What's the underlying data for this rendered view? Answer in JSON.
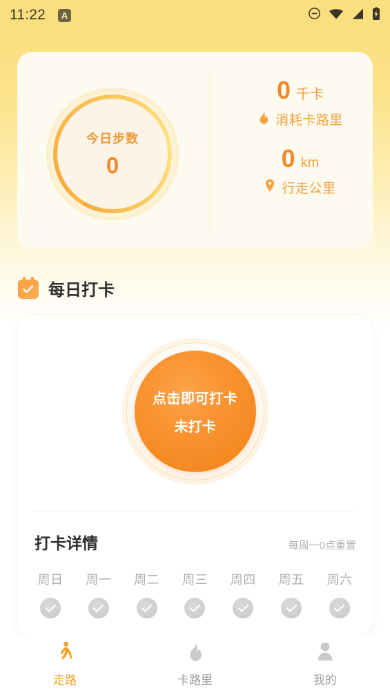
{
  "statusbar": {
    "time": "11:22",
    "badge_letter": "A",
    "icons": [
      "do-not-disturb-icon",
      "wifi-icon",
      "cellular-signal-icon",
      "battery-charging-icon"
    ]
  },
  "summary": {
    "steps": {
      "label": "今日步数",
      "value": "0"
    },
    "calories": {
      "value": "0",
      "unit": "千卡",
      "caption": "消耗卡路里",
      "icon": "flame-icon"
    },
    "distance": {
      "value": "0",
      "unit": "km",
      "caption": "行走公里",
      "icon": "location-pin-icon"
    }
  },
  "section": {
    "title": "每日打卡",
    "icon": "calendar-check-icon"
  },
  "checkin": {
    "button_line1": "点击即可打卡",
    "button_line2": "未打卡",
    "detail_title": "打卡详情",
    "detail_note": "每周一0点重置",
    "days": [
      {
        "label": "周日",
        "checked": false
      },
      {
        "label": "周一",
        "checked": false
      },
      {
        "label": "周二",
        "checked": false
      },
      {
        "label": "周三",
        "checked": false
      },
      {
        "label": "周四",
        "checked": false
      },
      {
        "label": "周五",
        "checked": false
      },
      {
        "label": "周六",
        "checked": false
      }
    ]
  },
  "bottomnav": {
    "items": [
      {
        "label": "走路",
        "icon": "walking-person-icon",
        "active": true
      },
      {
        "label": "卡路里",
        "icon": "flame-icon",
        "active": false
      },
      {
        "label": "我的",
        "icon": "person-icon",
        "active": false
      }
    ]
  },
  "colors": {
    "accent_orange": "#f0892a",
    "accent_amber": "#f4a227",
    "background_yellow": "#fbdf7f",
    "card_cream": "#fdfaf0",
    "card_white": "#ffffff",
    "muted_gray": "#9e9e9e"
  }
}
